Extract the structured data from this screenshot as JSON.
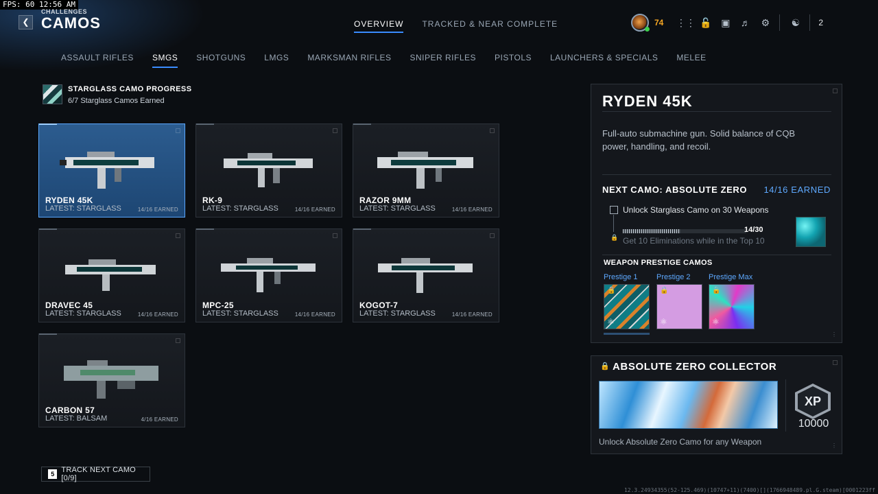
{
  "overlay": {
    "fps_label": "FPS:",
    "fps_value": "60",
    "time": "12:56 AM"
  },
  "header": {
    "breadcrumb": "CHALLENGES",
    "title": "CAMOS",
    "tabs": [
      {
        "label": "OVERVIEW",
        "active": true
      },
      {
        "label": "TRACKED & NEAR COMPLETE",
        "active": false
      }
    ],
    "player_level": "74",
    "party_count": "2"
  },
  "categories": [
    {
      "label": "ASSAULT RIFLES",
      "active": false
    },
    {
      "label": "SMGS",
      "active": true
    },
    {
      "label": "SHOTGUNS",
      "active": false
    },
    {
      "label": "LMGS",
      "active": false
    },
    {
      "label": "MARKSMAN RIFLES",
      "active": false
    },
    {
      "label": "SNIPER RIFLES",
      "active": false
    },
    {
      "label": "PISTOLS",
      "active": false
    },
    {
      "label": "LAUNCHERS & SPECIALS",
      "active": false
    },
    {
      "label": "MELEE",
      "active": false
    }
  ],
  "progress": {
    "title": "STARGLASS CAMO PROGRESS",
    "subtitle": "6/7 Starglass Camos Earned"
  },
  "weapons": [
    {
      "name": "RYDEN 45K",
      "latest": "LATEST: STARGLASS",
      "earned": "14/16 EARNED"
    },
    {
      "name": "RK-9",
      "latest": "LATEST: STARGLASS",
      "earned": "14/16 EARNED"
    },
    {
      "name": "RAZOR 9MM",
      "latest": "LATEST: STARGLASS",
      "earned": "14/16 EARNED"
    },
    {
      "name": "DRAVEC 45",
      "latest": "LATEST: STARGLASS",
      "earned": "14/16 EARNED"
    },
    {
      "name": "MPC-25",
      "latest": "LATEST: STARGLASS",
      "earned": "14/16 EARNED"
    },
    {
      "name": "KOGOT-7",
      "latest": "LATEST: STARGLASS",
      "earned": "14/16 EARNED"
    },
    {
      "name": "CARBON 57",
      "latest": "LATEST: BALSAM",
      "earned": "4/16 EARNED"
    }
  ],
  "detail": {
    "name": "RYDEN 45K",
    "description": "Full-auto submachine gun. Solid balance of CQB power, handling, and recoil.",
    "next_camo_label": "NEXT CAMO: ABSOLUTE ZERO",
    "earned": "14/16 EARNED",
    "challenge": "Unlock Starglass Camo on 30 Weapons",
    "challenge_progress": "14/30",
    "challenge_progress_fraction": 0.467,
    "locked_challenge": "Get 10 Eliminations while in the Top 10",
    "prestige_title": "WEAPON PRESTIGE CAMOS",
    "prestige": [
      {
        "label": "Prestige 1"
      },
      {
        "label": "Prestige 2"
      },
      {
        "label": "Prestige Max"
      }
    ]
  },
  "collector": {
    "title": "ABSOLUTE ZERO COLLECTOR",
    "xp_badge": "XP",
    "xp_amount": "10000",
    "description": "Unlock Absolute Zero Camo for any Weapon"
  },
  "footer": {
    "track_key": "5",
    "track_label": "TRACK NEXT CAMO [0/9]",
    "build": "12.3.24934355(52-125.469)(10747+11)(7400)[](1766948489.pl.G.steam)[0001223ff"
  },
  "icons": {
    "back": "chevron-left-icon",
    "lock": "lock-icon",
    "xp": "xp-badge-icon"
  },
  "colors": {
    "accent": "#3a8cff",
    "earned_blue": "#5ea9ff",
    "level": "#f5a623"
  }
}
